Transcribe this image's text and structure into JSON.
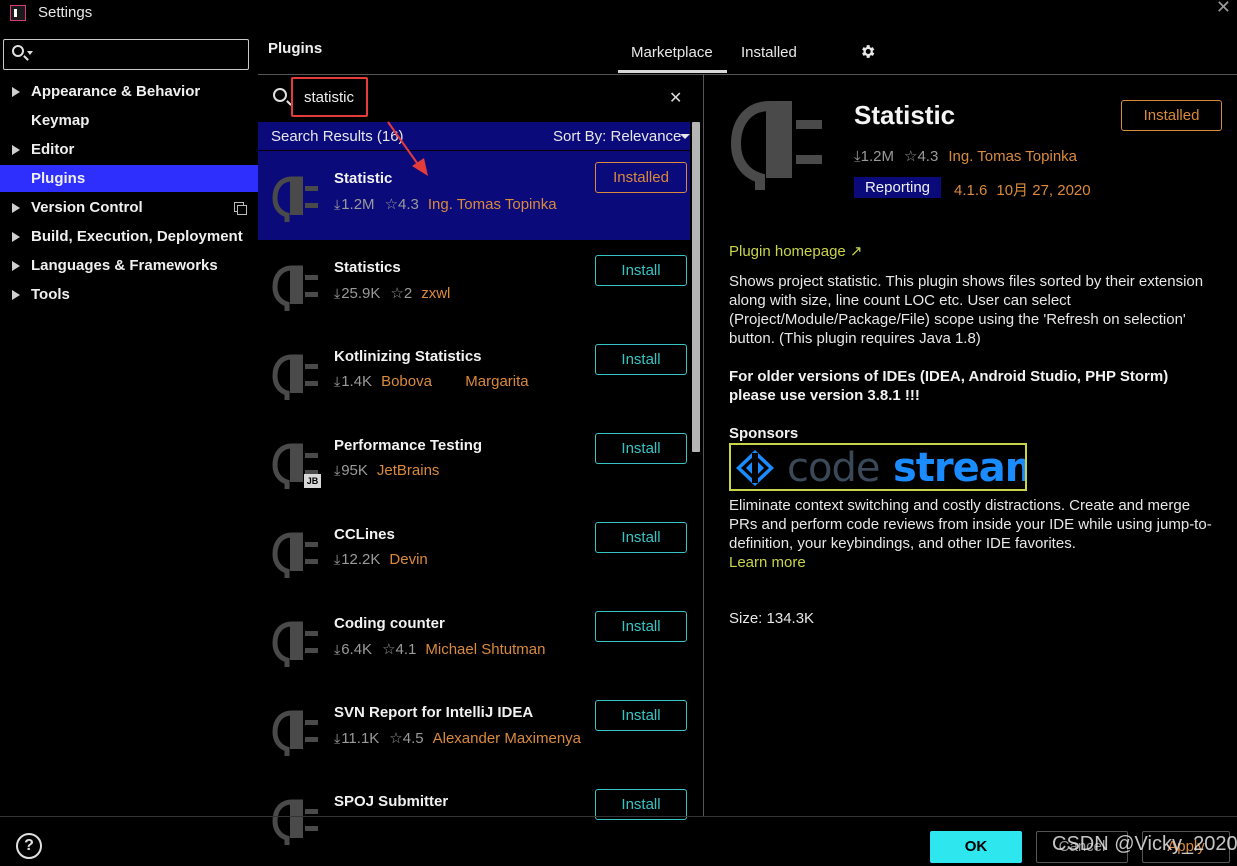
{
  "window": {
    "title": "Settings"
  },
  "sidebar": {
    "items": [
      {
        "label": "Appearance & Behavior",
        "expandable": true
      },
      {
        "label": "Keymap",
        "expandable": false
      },
      {
        "label": "Editor",
        "expandable": true
      },
      {
        "label": "Plugins",
        "expandable": false,
        "selected": true
      },
      {
        "label": "Version Control",
        "expandable": true
      },
      {
        "label": "Build, Execution, Deployment",
        "expandable": true
      },
      {
        "label": "Languages & Frameworks",
        "expandable": true
      },
      {
        "label": "Tools",
        "expandable": true
      }
    ]
  },
  "header": {
    "title": "Plugins",
    "tabs": [
      {
        "label": "Marketplace",
        "active": true
      },
      {
        "label": "Installed",
        "active": false
      }
    ],
    "settings_icon": "gear-icon"
  },
  "search": {
    "value": "statistic"
  },
  "results": {
    "label": "Search Results (16)",
    "sort_label": "Sort By: Relevance"
  },
  "plugins": [
    {
      "name": "Statistic",
      "downloads": "1.2M",
      "rating": "4.3",
      "vendor": "Ing. Tomas Topinka",
      "action": "Installed",
      "selected": true
    },
    {
      "name": "Statistics",
      "downloads": "25.9K",
      "rating": "2",
      "vendor": "zxwl",
      "action": "Install"
    },
    {
      "name": "Kotlinizing Statistics",
      "downloads": "1.4K",
      "rating": "",
      "vendor": "Bobova        Margarita",
      "action": "Install"
    },
    {
      "name": "Performance Testing",
      "downloads": "95K",
      "rating": "",
      "vendor": "JetBrains",
      "action": "Install",
      "badge": "JB"
    },
    {
      "name": "CCLines",
      "downloads": "12.2K",
      "rating": "",
      "vendor": "Devin",
      "action": "Install"
    },
    {
      "name": "Coding counter",
      "downloads": "6.4K",
      "rating": "4.1",
      "vendor": "Michael Shtutman",
      "action": "Install"
    },
    {
      "name": "SVN Report for IntelliJ IDEA",
      "downloads": "11.1K",
      "rating": "4.5",
      "vendor": "Alexander Maximenya",
      "action": "Install"
    },
    {
      "name": "SPOJ Submitter",
      "downloads": "",
      "rating": "",
      "vendor": "",
      "action": "Install"
    }
  ],
  "detail": {
    "name": "Statistic",
    "action": "Installed",
    "downloads": "1.2M",
    "rating": "4.3",
    "vendor": "Ing. Tomas Topinka",
    "tag": "Reporting",
    "version": "4.1.6",
    "date": "10月 27, 2020",
    "homepage": "Plugin homepage ↗",
    "description": "Shows project statistic. This plugin shows files sorted by their extension along with size, line count LOC etc. User can select (Project/Module/Package/File) scope using the 'Refresh on selection' button. (This plugin requires Java 1.8)",
    "note": "For older versions of IDEs (IDEA, Android Studio, PHP Storm) please use version 3.8.1 !!!",
    "sponsors_label": "Sponsors",
    "sponsor_logo": {
      "word1": "code",
      "word2": "stream"
    },
    "sponsor_text": "Eliminate context switching and costly distractions. Create and merge PRs and perform code reviews from inside your IDE while using jump-to-definition, your keybindings, and other IDE favorites.",
    "learn_more": "Learn more",
    "size": "Size: 134.3K"
  },
  "footer": {
    "help": "?",
    "ok": "OK",
    "cancel": "Cancel",
    "apply": "Apply",
    "watermark": "CSDN @Vicky_2020"
  },
  "colors": {
    "accent": "#2ee6ee",
    "selection": "#0a0a7a",
    "sidebar_selection": "#2f2ffd",
    "vendor": "#d98a3d",
    "link": "#c9d44a",
    "annotation": "#e43b3b"
  }
}
